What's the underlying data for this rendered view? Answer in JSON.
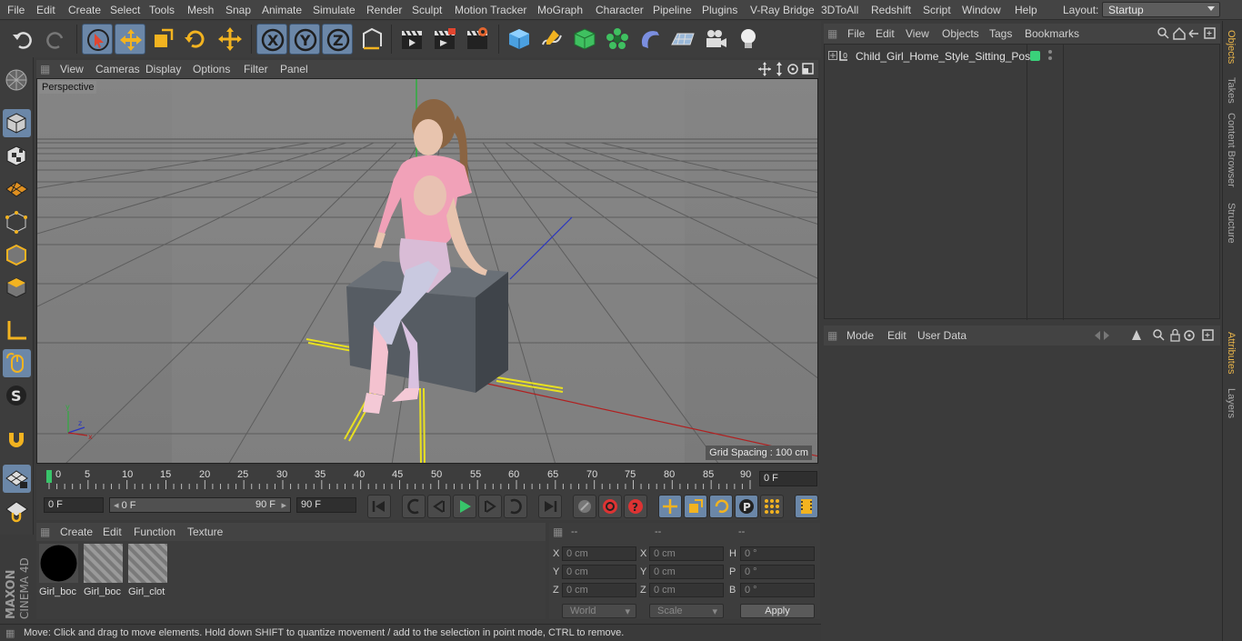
{
  "menubar": {
    "items": [
      "File",
      "Edit",
      "Create",
      "Select",
      "Tools",
      "Mesh",
      "Snap",
      "Animate",
      "Simulate",
      "Render",
      "Sculpt",
      "Motion Tracker",
      "MoGraph",
      "Character",
      "Pipeline",
      "Plugins",
      "V-Ray Bridge",
      "3DToAll",
      "Redshift",
      "Script",
      "Window",
      "Help"
    ],
    "layout_label": "Layout:",
    "layout_value": "Startup"
  },
  "viewport": {
    "menu": [
      "View",
      "Cameras",
      "Display",
      "Options",
      "Filter",
      "Panel"
    ],
    "label": "Perspective",
    "grid_spacing": "Grid Spacing : 100 cm"
  },
  "timeline": {
    "ticks": [
      "0",
      "5",
      "10",
      "15",
      "20",
      "25",
      "30",
      "35",
      "40",
      "45",
      "50",
      "55",
      "60",
      "65",
      "70",
      "75",
      "80",
      "85",
      "90"
    ],
    "current_frame": "0 F"
  },
  "transport": {
    "start": "0 F",
    "range_start": "0 F",
    "range_end": "90 F",
    "end": "90 F"
  },
  "materials": {
    "menu": [
      "Create",
      "Edit",
      "Function",
      "Texture"
    ],
    "items": [
      {
        "name": "Girl_boc"
      },
      {
        "name": "Girl_boc"
      },
      {
        "name": "Girl_clot"
      }
    ]
  },
  "coordinates": {
    "headers": [
      "--",
      "--",
      "--"
    ],
    "rows": [
      {
        "l1": "X",
        "v1": "0 cm",
        "l2": "X",
        "v2": "0 cm",
        "l3": "H",
        "v3": "0 °"
      },
      {
        "l1": "Y",
        "v1": "0 cm",
        "l2": "Y",
        "v2": "0 cm",
        "l3": "P",
        "v3": "0 °"
      },
      {
        "l1": "Z",
        "v1": "0 cm",
        "l2": "Z",
        "v2": "0 cm",
        "l3": "B",
        "v3": "0 °"
      }
    ],
    "space": "World",
    "mode": "Scale",
    "apply": "Apply"
  },
  "status": "Move: Click and drag to move elements. Hold down SHIFT to quantize movement / add to the selection in point mode, CTRL to remove.",
  "objects": {
    "menu": [
      "File",
      "Edit",
      "View",
      "Objects",
      "Tags",
      "Bookmarks"
    ],
    "items": [
      {
        "name": "Child_Girl_Home_Style_Sitting_Pose",
        "tag_color": "#3ad17a"
      }
    ]
  },
  "attributes": {
    "menu": [
      "Mode",
      "Edit",
      "User Data"
    ]
  },
  "side_tabs": [
    "Objects",
    "Takes",
    "Content Browser",
    "Structure",
    "Attributes",
    "Layers"
  ],
  "logo": {
    "line1": "MAXON",
    "line2": "CINEMA 4D"
  },
  "colors": {
    "accent": "#6b87a8",
    "active_tab": "#e8b44a",
    "playhead": "#38c46a"
  }
}
